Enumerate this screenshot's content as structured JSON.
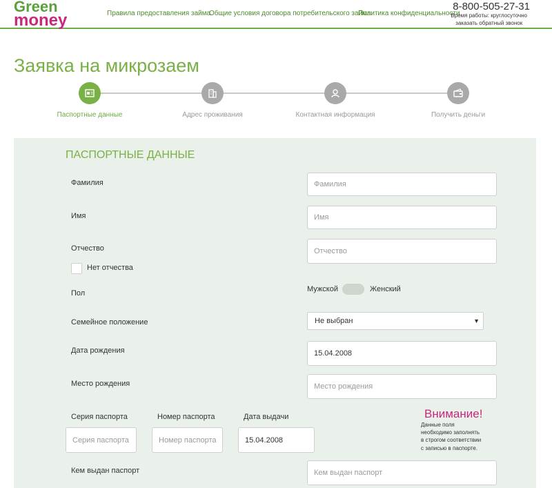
{
  "header": {
    "logo_top": "Green",
    "logo_bottom": "money",
    "nav": [
      "Правила предоставления займа",
      "Общие условия договора потребительского займа",
      "Политика конфиденциальности"
    ],
    "phone": "8-800-505-27-31",
    "hours": "Время работы: круглосуточно",
    "callback": "заказать обратный звонок"
  },
  "page_title": "Заявка на микрозаем",
  "steps": [
    {
      "label": "Паспортные данные",
      "icon": "passport-icon",
      "active": true
    },
    {
      "label": "Адрес проживания",
      "icon": "building-icon",
      "active": false
    },
    {
      "label": "Контактная информация",
      "icon": "person-icon",
      "active": false
    },
    {
      "label": "Получить деньги",
      "icon": "wallet-icon",
      "active": false
    }
  ],
  "form": {
    "section_title": "ПАСПОРТНЫЕ ДАННЫЕ",
    "last_name": {
      "label": "Фамилия",
      "placeholder": "Фамилия"
    },
    "first_name": {
      "label": "Имя",
      "placeholder": "Имя"
    },
    "patronymic": {
      "label": "Отчество",
      "placeholder": "Отчество"
    },
    "no_patronymic": "Нет отчества",
    "gender": {
      "label": "Пол",
      "male": "Мужской",
      "female": "Женский"
    },
    "marital": {
      "label": "Семейное положение",
      "value": "Не выбран"
    },
    "birth_date": {
      "label": "Дата рождения",
      "value": "15.04.2008"
    },
    "birth_place": {
      "label": "Место рождения",
      "placeholder": "Место рождения"
    },
    "passport_series": {
      "label": "Серия паспорта",
      "placeholder": "Серия паспорта"
    },
    "passport_number": {
      "label": "Номер паспорта",
      "placeholder": "Номер паспорта"
    },
    "issue_date": {
      "label": "Дата выдачи",
      "value": "15.04.2008"
    },
    "issued_by": {
      "label": "Кем выдан паспорт",
      "placeholder": "Кем выдан паспорт"
    },
    "warning_title": "Внимание!",
    "warning_lines": [
      "Данные поля",
      "необходимо заполнять",
      "в строгом соответствии",
      "с записью в паспорте."
    ]
  },
  "colors": {
    "brand_green": "#79b146",
    "brand_pink": "#c8287f",
    "panel_bg": "#eaf0ea"
  }
}
